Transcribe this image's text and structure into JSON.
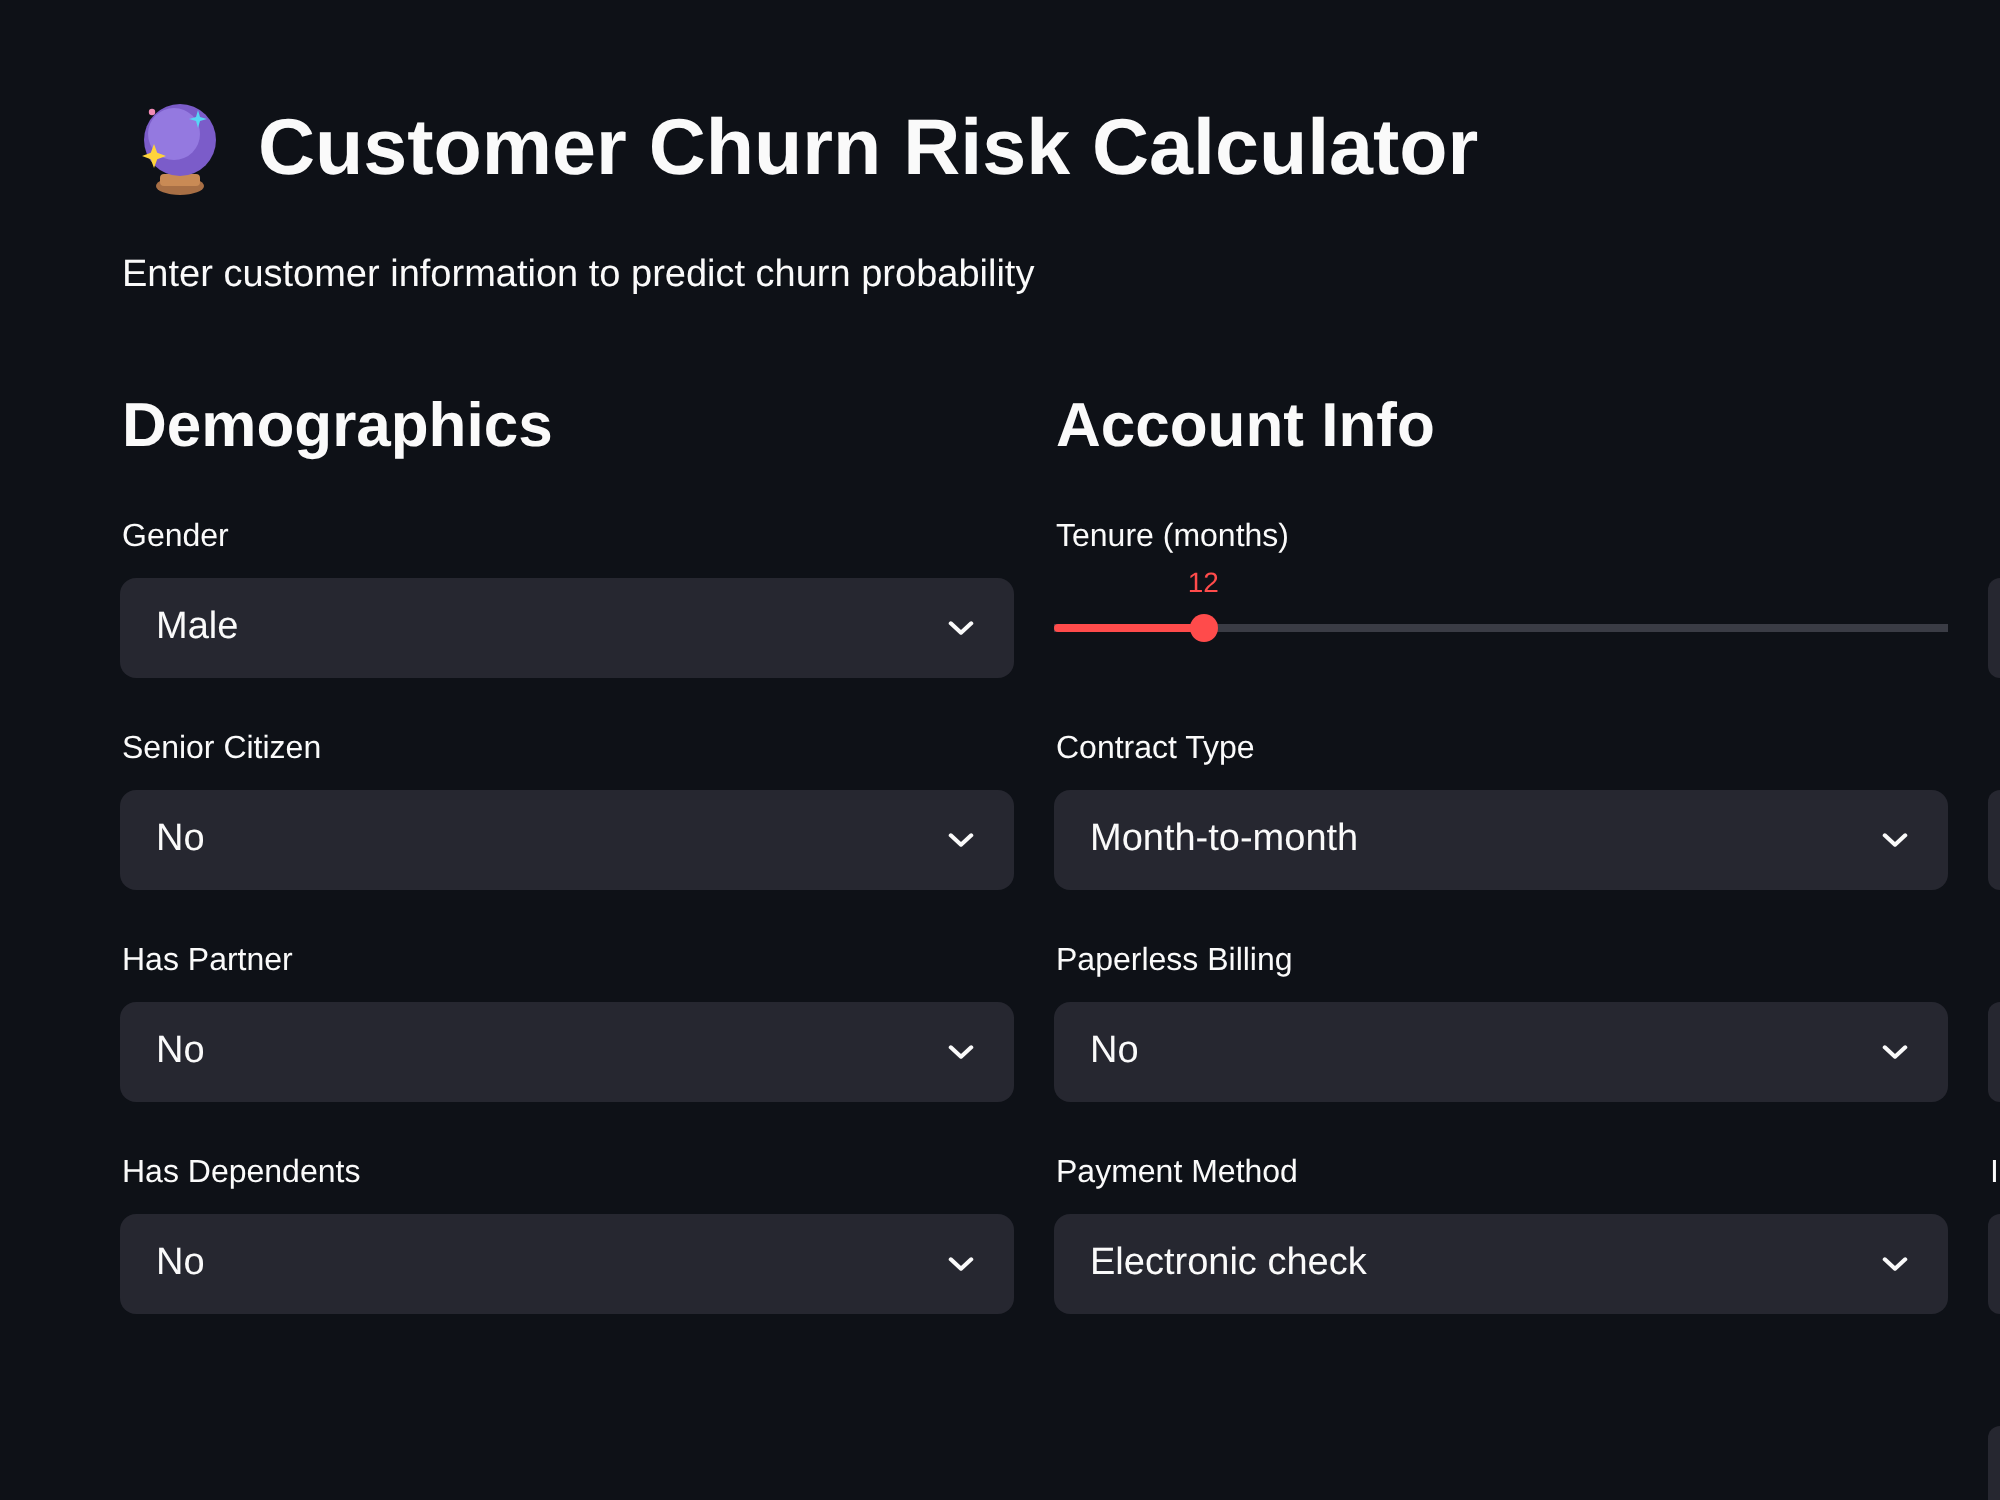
{
  "app": {
    "title": "Customer Churn Risk Calculator",
    "subtitle": "Enter customer information to predict churn probability"
  },
  "columns": [
    {
      "heading": "Demographics",
      "fields": [
        {
          "kind": "select",
          "label": "Gender",
          "value": "Male"
        },
        {
          "kind": "select",
          "label": "Senior Citizen",
          "value": "No"
        },
        {
          "kind": "select",
          "label": "Has Partner",
          "value": "No"
        },
        {
          "kind": "select",
          "label": "Has Dependents",
          "value": "No"
        }
      ]
    },
    {
      "heading": "Account Info",
      "fields": [
        {
          "kind": "slider",
          "label": "Tenure (months)",
          "value": "12",
          "level": 0.167
        },
        {
          "kind": "select",
          "label": "Contract Type",
          "value": "Month-to-month"
        },
        {
          "kind": "select",
          "label": "Paperless Billing",
          "value": "No"
        },
        {
          "kind": "select",
          "label": "Payment Method",
          "value": "Electronic check"
        }
      ]
    },
    {
      "fields": [
        {
          "kind": "select"
        },
        {
          "kind": "select"
        },
        {
          "kind": "select"
        },
        {
          "kind": "select",
          "label": "I"
        },
        {
          "kind": "select"
        }
      ]
    }
  ]
}
